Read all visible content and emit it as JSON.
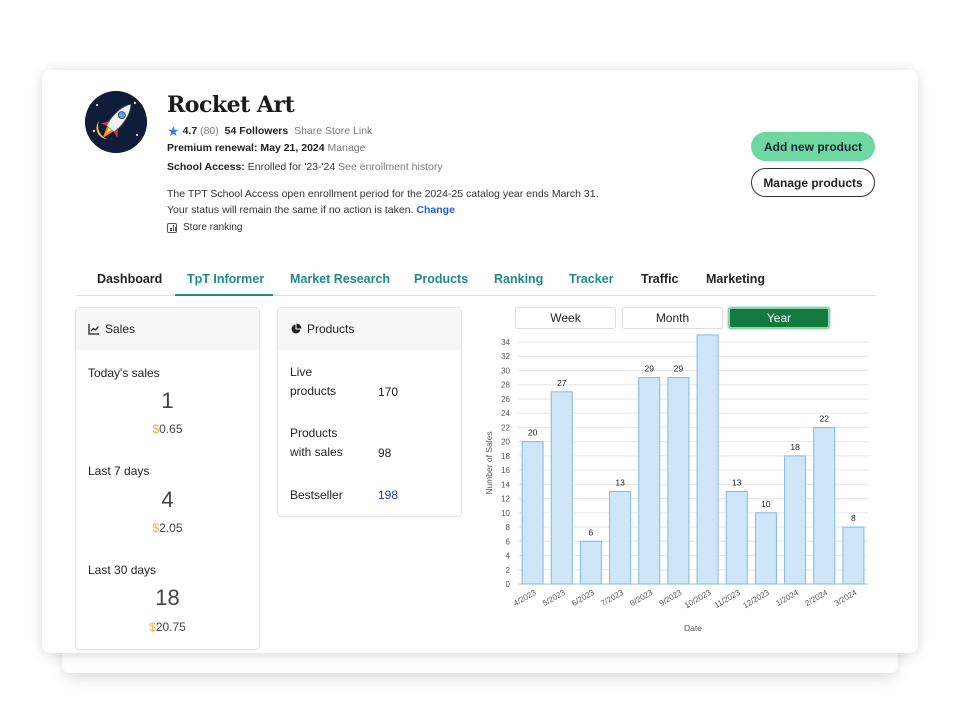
{
  "store": {
    "name": "Rocket Art",
    "rating": "4.7",
    "rating_count": "(80)",
    "followers": "54 Followers",
    "share_link": "Share Store Link",
    "premium_label": "Premium renewal:",
    "premium_date": "May 21, 2024",
    "premium_manage": "Manage",
    "school_label": "School Access:",
    "school_status": "Enrolled for '23-'24",
    "school_history": "See enrollment history",
    "notice_line1": "The TPT School Access open enrollment period for the 2024-25 catalog year ends March 31.",
    "notice_line2": "Your status will remain the same if no action is taken.",
    "notice_change": "Change",
    "ranking": "Store ranking"
  },
  "actions": {
    "add_product": "Add new product",
    "manage_products": "Manage products"
  },
  "tabs": [
    {
      "label": "Dashboard"
    },
    {
      "label": "TpT Informer"
    },
    {
      "label": "Market Research"
    },
    {
      "label": "Products"
    },
    {
      "label": "Ranking"
    },
    {
      "label": "Tracker"
    },
    {
      "label": "Traffic"
    },
    {
      "label": "Marketing"
    }
  ],
  "sales": {
    "title": "Sales",
    "today_label": "Today's sales",
    "today_count": "1",
    "today_amount": "0.65",
    "week_label": "Last 7 days",
    "week_count": "4",
    "week_amount": "2.05",
    "month_label": "Last 30 days",
    "month_count": "18",
    "month_amount": "20.75",
    "currency": "$"
  },
  "products": {
    "title": "Products",
    "live_label_1": "Live",
    "live_label_2": "products",
    "live_value": "170",
    "with_sales_label_1": "Products",
    "with_sales_label_2": "with sales",
    "with_sales_value": "98",
    "bestseller_label": "Bestseller",
    "bestseller_value": "198"
  },
  "period": {
    "week": "Week",
    "month": "Month",
    "year": "Year",
    "selected": "Year"
  },
  "colors": {
    "accent": "#1f8a8a",
    "add_button": "#6fd7a0",
    "year_active": "#137a3f",
    "bar_fill": "#cfe6f8",
    "bar_stroke": "#7fb8e6"
  },
  "chart_data": {
    "type": "bar",
    "categories": [
      "4/2023",
      "5/2023",
      "6/2023",
      "7/2023",
      "8/2023",
      "9/2023",
      "10/2023",
      "11/2023",
      "12/2023",
      "1/2024",
      "2/2024",
      "3/2024"
    ],
    "values": [
      20,
      27,
      6,
      13,
      29,
      29,
      35,
      13,
      10,
      18,
      22,
      8
    ],
    "xlabel": "Date",
    "ylabel": "Number of Sales",
    "ylim": [
      0,
      34
    ],
    "yticks": [
      0,
      2,
      4,
      6,
      8,
      10,
      12,
      14,
      16,
      18,
      20,
      22,
      24,
      26,
      28,
      30,
      32,
      34
    ],
    "grid": true
  }
}
